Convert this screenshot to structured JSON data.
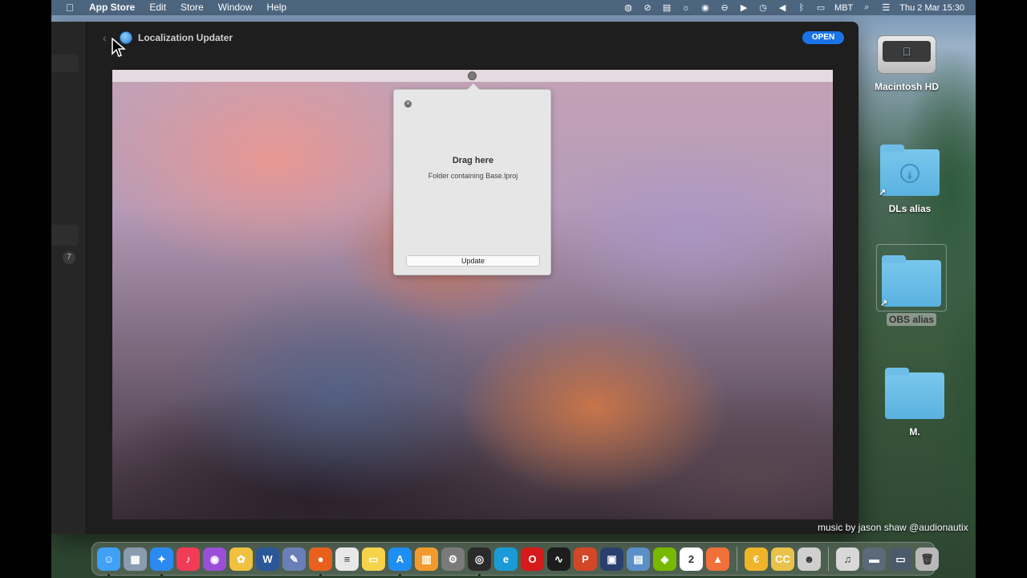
{
  "menubar": {
    "apple_icon": "apple-logo-icon",
    "app_name": "App Store",
    "items": [
      "Edit",
      "Store",
      "Window",
      "Help"
    ],
    "status": {
      "keyboard_layout": "MBT",
      "date_time": "Thu 2 Mar  15:30"
    }
  },
  "window": {
    "app_title": "Localization Updater",
    "open_button": "OPEN",
    "sidebar_badge": "7"
  },
  "preview": {
    "drag_title": "Drag here",
    "drag_subtitle": "Folder containing Base.lproj",
    "update_button": "Update"
  },
  "desktop": {
    "items": [
      {
        "label": "Macintosh HD",
        "icon": "hard-drive-icon"
      },
      {
        "label": "DLs alias",
        "icon": "downloads-folder-icon"
      },
      {
        "label": "OBS alias",
        "icon": "folder-icon"
      },
      {
        "label": "M.",
        "icon": "folder-icon"
      }
    ]
  },
  "caption": "music by jason shaw @audionautix",
  "dock": {
    "apps": [
      {
        "name": "Finder",
        "color": "#3fa0f5",
        "glyph": "☺"
      },
      {
        "name": "Launchpad",
        "color": "#8b9bb0",
        "glyph": "▦"
      },
      {
        "name": "Safari",
        "color": "#2a8af0",
        "glyph": "✦"
      },
      {
        "name": "Music",
        "color": "#f23c55",
        "glyph": "♪"
      },
      {
        "name": "Podcasts",
        "color": "#9b4fd8",
        "glyph": "◉"
      },
      {
        "name": "Photos",
        "color": "#f0c040",
        "glyph": "✿"
      },
      {
        "name": "Word",
        "color": "#2b5797",
        "glyph": "W"
      },
      {
        "name": "Ruler",
        "color": "#6a7fb8",
        "glyph": "✎"
      },
      {
        "name": "Firefox",
        "color": "#e8601c",
        "glyph": "●"
      },
      {
        "name": "TextEdit",
        "color": "#e8e8e8",
        "glyph": "≡"
      },
      {
        "name": "Notes",
        "color": "#f5d34a",
        "glyph": "▭"
      },
      {
        "name": "App Store",
        "color": "#1f8ef1",
        "glyph": "A"
      },
      {
        "name": "Books",
        "color": "#f29b2c",
        "glyph": "▥"
      },
      {
        "name": "System Preferences",
        "color": "#7a7a7a",
        "glyph": "⚙"
      },
      {
        "name": "OBS",
        "color": "#2a2a2a",
        "glyph": "◎"
      },
      {
        "name": "Edge",
        "color": "#1a9ad6",
        "glyph": "e"
      },
      {
        "name": "Opera",
        "color": "#d61a1a",
        "glyph": "O"
      },
      {
        "name": "Activity Monitor",
        "color": "#1d1d1d",
        "glyph": "∿"
      },
      {
        "name": "PowerPoint",
        "color": "#d24726",
        "glyph": "P"
      },
      {
        "name": "Screen Recorder",
        "color": "#2b3f6e",
        "glyph": "▣"
      },
      {
        "name": "Preview",
        "color": "#5a8fc8",
        "glyph": "▤"
      },
      {
        "name": "Nvidia",
        "color": "#76b900",
        "glyph": "◈"
      },
      {
        "name": "Calendar",
        "color": "#ffffff",
        "glyph": "2"
      },
      {
        "name": "Swift Playgrounds",
        "color": "#f0703a",
        "glyph": "▲"
      },
      {
        "name": "Currency",
        "color": "#f0b429",
        "glyph": "€"
      },
      {
        "name": "Closed Captions",
        "color": "#e8c24a",
        "glyph": "CC"
      },
      {
        "name": "Mascot",
        "color": "#cfcfcf",
        "glyph": "☻"
      },
      {
        "name": "Music Docs",
        "color": "#d8d8d8",
        "glyph": "♫"
      },
      {
        "name": "Movie",
        "color": "#5a6a78",
        "glyph": "▬"
      },
      {
        "name": "Projector",
        "color": "#4a5a68",
        "glyph": "▭"
      },
      {
        "name": "Trash",
        "color": "#b8b8b8",
        "glyph": "🗑"
      }
    ]
  }
}
